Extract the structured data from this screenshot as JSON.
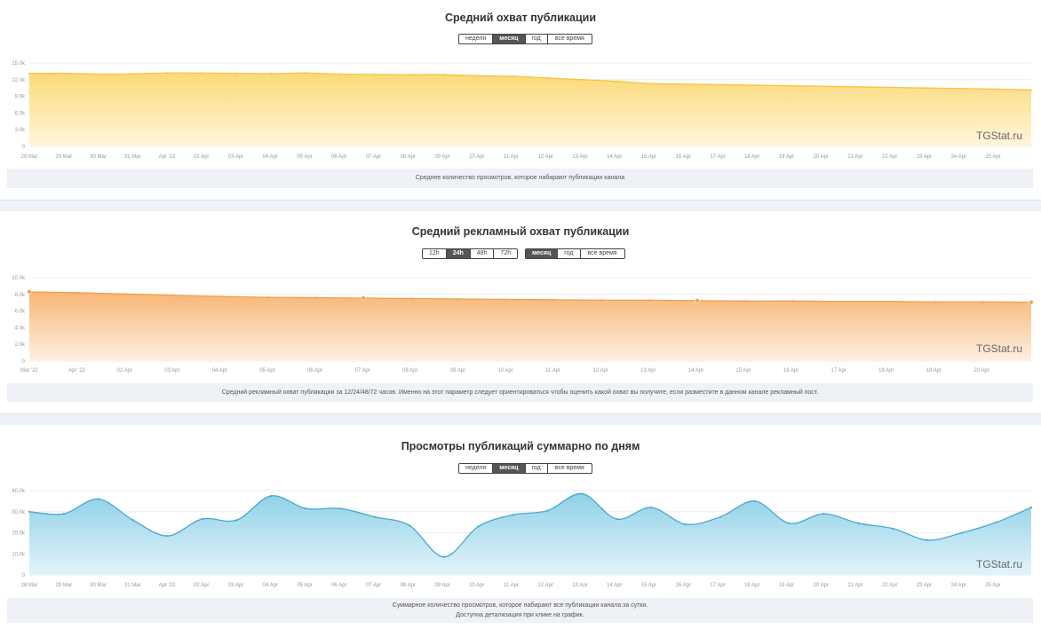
{
  "watermark": "TGStat.ru",
  "charts": [
    {
      "title": "Средний охват публикации",
      "buttons": [
        {
          "label": "неделя",
          "active": false
        },
        {
          "label": "месяц",
          "active": true
        },
        {
          "label": "год",
          "active": false
        },
        {
          "label": "все время",
          "active": false
        }
      ],
      "description": [
        "Среднее количество просмотров, которое набирают публикации канала"
      ]
    },
    {
      "title": "Средний рекламный охват публикации",
      "buttons_hours": [
        {
          "label": "12h",
          "active": false
        },
        {
          "label": "24h",
          "active": true
        },
        {
          "label": "48h",
          "active": false
        },
        {
          "label": "72h",
          "active": false
        }
      ],
      "buttons_period": [
        {
          "label": "месяц",
          "active": true
        },
        {
          "label": "год",
          "active": false
        },
        {
          "label": "все время",
          "active": false
        }
      ],
      "description": [
        "Средний рекламный охват публикации за 12/24/48/72 часов. Именно на этот параметр следует ориентироваться чтобы оценить какой охват вы получите, если разместите в данном канале рекламный пост."
      ]
    },
    {
      "title": "Просмотры публикаций суммарно по дням",
      "buttons": [
        {
          "label": "неделя",
          "active": false
        },
        {
          "label": "месяц",
          "active": true
        },
        {
          "label": "год",
          "active": false
        },
        {
          "label": "все время",
          "active": false
        }
      ],
      "description": [
        "Суммарное количество просмотров, которое набирают все публикации канала за сутки.",
        "Доступна детализация при клике на график."
      ]
    }
  ],
  "chart_data": [
    {
      "type": "area",
      "color": "#f5c542",
      "fill_top": "#fbd977",
      "fill_bottom": "#fff6dc",
      "yticks": [
        "0",
        "3.0k",
        "6.0k",
        "9.0k",
        "12.0k",
        "15.0k"
      ],
      "ylim": [
        0,
        15000
      ],
      "categories": [
        "28 Mar",
        "29 Mar",
        "30 Mar",
        "31 Mar",
        "Apr '22",
        "02 Apr",
        "03 Apr",
        "04 Apr",
        "05 Apr",
        "06 Apr",
        "07 Apr",
        "08 Apr",
        "09 Apr",
        "10 Apr",
        "11 Apr",
        "12 Apr",
        "13 Apr",
        "14 Apr",
        "15 Apr",
        "16 Apr",
        "17 Apr",
        "18 Apr",
        "19 Apr",
        "20 Apr",
        "21 Apr",
        "22 Apr",
        "23 Apr",
        "24 Apr",
        "25 Apr"
      ],
      "x": [
        0,
        1,
        2,
        3,
        4,
        5,
        6,
        7,
        8,
        9,
        10,
        11,
        12,
        13,
        14,
        15,
        16,
        17,
        18,
        19,
        20,
        21,
        22,
        23,
        24,
        25,
        26,
        27,
        28,
        29
      ],
      "values": [
        13100,
        13150,
        13000,
        13050,
        13200,
        13200,
        13150,
        13100,
        13200,
        13000,
        12950,
        12900,
        12900,
        12700,
        12600,
        12300,
        12000,
        11700,
        11300,
        11200,
        11100,
        11000,
        10900,
        10800,
        10700,
        10600,
        10500,
        10400,
        10300,
        10150
      ],
      "series_name": "",
      "marker_indices": []
    },
    {
      "type": "area",
      "color": "#f0a04b",
      "fill_top": "#f7b574",
      "fill_bottom": "#fff0e2",
      "yticks": [
        "0",
        "2.0k",
        "4.0k",
        "6.0k",
        "8.0k",
        "10.0k"
      ],
      "ylim": [
        0,
        10000
      ],
      "categories": [
        "Mar '22",
        "Apr '22",
        "02 Apr",
        "03 Apr",
        "04 Apr",
        "05 Apr",
        "06 Apr",
        "07 Apr",
        "08 Apr",
        "09 Apr",
        "10 Apr",
        "11 Apr",
        "12 Apr",
        "13 Apr",
        "14 Apr",
        "15 Apr",
        "16 Apr",
        "17 Apr",
        "18 Apr",
        "19 Apr",
        "20 Apr"
      ],
      "x": [
        0,
        1,
        2,
        3,
        4,
        5,
        6,
        7,
        8,
        9,
        10,
        11,
        12,
        13,
        14,
        15,
        16,
        17,
        18,
        19,
        20,
        21
      ],
      "values": [
        8300,
        8200,
        8050,
        7900,
        7750,
        7650,
        7600,
        7550,
        7500,
        7450,
        7400,
        7350,
        7300,
        7300,
        7250,
        7200,
        7200,
        7150,
        7150,
        7100,
        7100,
        7050
      ],
      "series_name": "",
      "marker_indices": [
        0,
        7,
        14,
        21
      ]
    },
    {
      "type": "area",
      "color": "#45a9cf",
      "fill_top": "#8fd0e8",
      "fill_bottom": "#e3f4fa",
      "yticks": [
        "0",
        "10.0k",
        "20.0k",
        "30.0k",
        "40.0k"
      ],
      "ylim": [
        0,
        40000
      ],
      "categories": [
        "28 Mar",
        "29 Mar",
        "30 Mar",
        "31 Mar",
        "Apr '22",
        "02 Apr",
        "03 Apr",
        "04 Apr",
        "05 Apr",
        "06 Apr",
        "07 Apr",
        "08 Apr",
        "09 Apr",
        "10 Apr",
        "11 Apr",
        "12 Apr",
        "13 Apr",
        "14 Apr",
        "15 Apr",
        "16 Apr",
        "17 Apr",
        "18 Apr",
        "19 Apr",
        "20 Apr",
        "21 Apr",
        "22 Apr",
        "23 Apr",
        "24 Apr",
        "25 Apr"
      ],
      "x": [
        0,
        1,
        2,
        3,
        4,
        5,
        6,
        7,
        8,
        9,
        10,
        11,
        12,
        13,
        14,
        15,
        16,
        17,
        18,
        19,
        20,
        21,
        22,
        23,
        24,
        25,
        26,
        27,
        28,
        29
      ],
      "values": [
        30000,
        29000,
        36000,
        26000,
        18500,
        26500,
        26000,
        37500,
        31500,
        31500,
        27500,
        23500,
        8500,
        23000,
        28500,
        30500,
        38500,
        26500,
        32000,
        24000,
        27500,
        35000,
        24500,
        29000,
        24500,
        22000,
        16500,
        20000,
        25000,
        32000
      ],
      "series_name": "",
      "marker_indices": []
    }
  ]
}
